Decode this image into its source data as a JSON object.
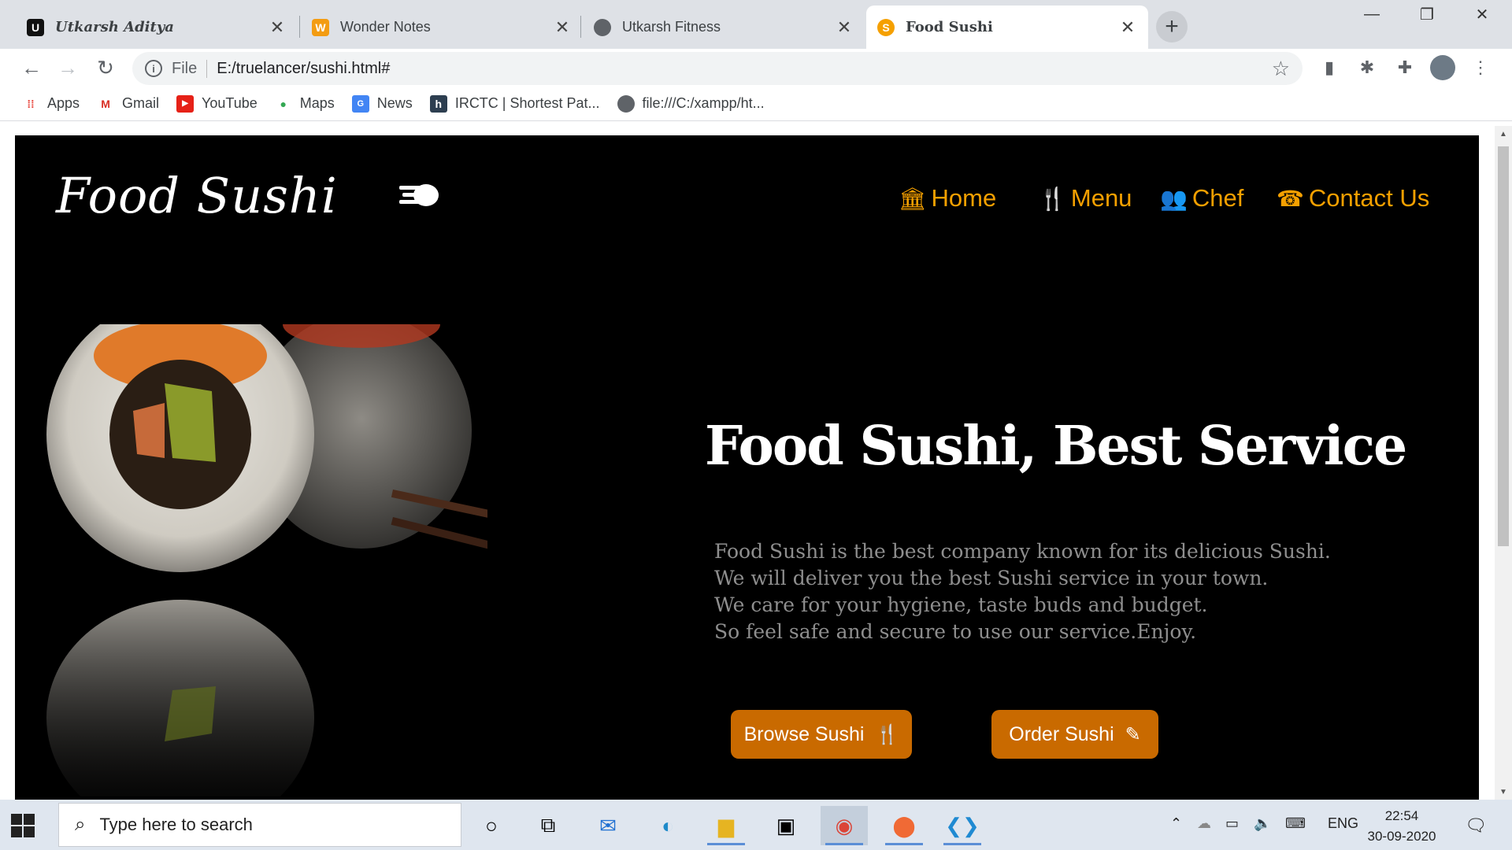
{
  "browser": {
    "tabs": [
      {
        "title": "Utkarsh Aditya",
        "favicon": "U"
      },
      {
        "title": "Wonder Notes",
        "favicon": "W"
      },
      {
        "title": "Utkarsh Fitness",
        "favicon": "globe"
      },
      {
        "title": "Food Sushi",
        "favicon": "S"
      }
    ],
    "new_tab_label": "+",
    "omnibox": {
      "scheme": "File",
      "url": "E:/truelancer/sushi.html#"
    },
    "bookmarks": [
      "Apps",
      "Gmail",
      "YouTube",
      "Maps",
      "News",
      "IRCTC | Shortest Pat...",
      "file:///C:/xampp/ht..."
    ]
  },
  "site": {
    "logo": "Food Sushi",
    "nav": [
      {
        "label": "Home",
        "icon": "institution-icon"
      },
      {
        "label": "Menu",
        "icon": "cutlery-icon"
      },
      {
        "label": "Chef",
        "icon": "users-icon"
      },
      {
        "label": "Contact Us",
        "icon": "phone-square-icon"
      }
    ],
    "headline": "Food Sushi, Best Service",
    "description": [
      "Food Sushi is the best company known for its delicious Sushi.",
      "We will deliver you the best Sushi service in your town.",
      "We care for your hygiene, taste buds and budget.",
      "So feel safe and secure to use our service.Enjoy."
    ],
    "buttons": {
      "browse": "Browse Sushi",
      "order": "Order Sushi"
    },
    "accent_color": "#f5a000",
    "button_color": "#c96a00"
  },
  "taskbar": {
    "search_placeholder": "Type here to search",
    "language": "ENG",
    "time": "22:54",
    "date": "30-09-2020"
  }
}
